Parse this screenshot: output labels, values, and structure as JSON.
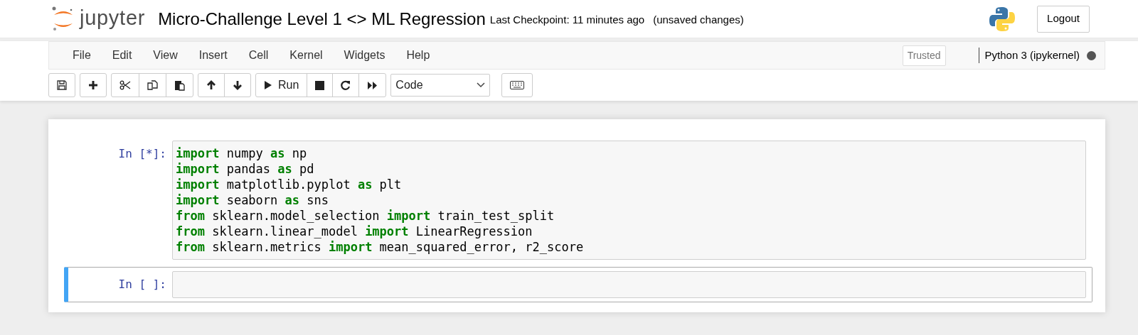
{
  "header": {
    "logo_text": "jupyter",
    "notebook_title": "Micro-Challenge Level 1 <> ML Regression",
    "checkpoint": "Last Checkpoint: 11 minutes ago",
    "save_status": "(unsaved changes)",
    "logout": "Logout"
  },
  "menu": [
    "File",
    "Edit",
    "View",
    "Insert",
    "Cell",
    "Kernel",
    "Widgets",
    "Help"
  ],
  "trusted": "Trusted",
  "kernel": {
    "name": "Python 3 (ipykernel)",
    "busy": true
  },
  "toolbar": {
    "run_label": "Run",
    "cell_type": "Code"
  },
  "cells": [
    {
      "prompt": "In [*]:",
      "selected": false,
      "lines": [
        "**import** numpy **as** np",
        "**import** pandas **as** pd",
        "**import** matplotlib.pyplot **as** plt",
        "**import** seaborn **as** sns",
        "**from** sklearn.model_selection **import** train_test_split",
        "**from** sklearn.linear_model **import** LinearRegression",
        "**from** sklearn.metrics **import** mean_squared_error, r2_score"
      ]
    },
    {
      "prompt": "In [ ]:",
      "selected": true
    }
  ]
}
